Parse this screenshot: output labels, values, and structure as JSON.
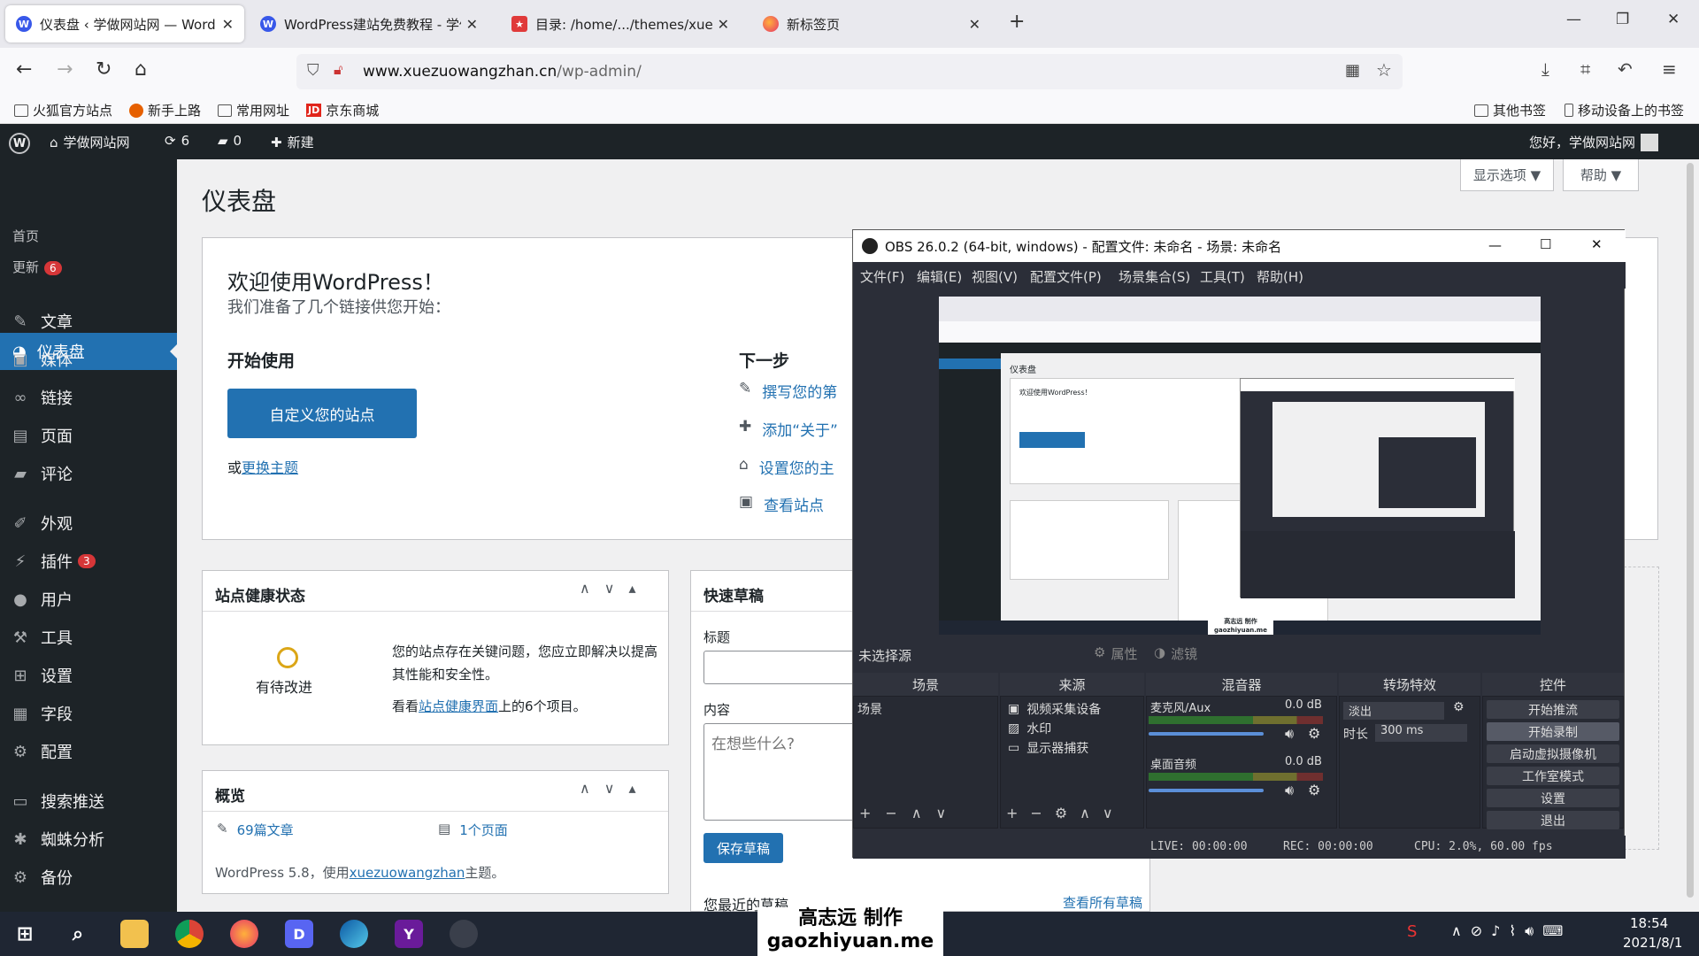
{
  "browser": {
    "tabs": [
      {
        "label": "仪表盘 ‹ 学做网站网 — WordP",
        "active": true,
        "favicon": "wordpress-icon"
      },
      {
        "label": "WordPress建站免费教程 - 学做",
        "active": false,
        "favicon": "wordpress-icon"
      },
      {
        "label": "目录: /home/.../themes/xuezu",
        "active": false,
        "favicon": "bookmark-star-icon"
      },
      {
        "label": "新标签页",
        "active": false,
        "favicon": "firefox-icon"
      }
    ],
    "new_tab": "+",
    "url_domain": "www.xuezuowangzhan.cn",
    "url_path": "/wp-admin/",
    "bookmarks": [
      "火狐官方站点",
      "新手上路",
      "常用网址",
      "京东商城"
    ],
    "bookmarks_right": [
      "其他书签",
      "移动设备上的书签"
    ]
  },
  "adminbar": {
    "site": "学做网站网",
    "updates": "6",
    "comments": "0",
    "new": "新建",
    "greeting": "您好，学做网站网"
  },
  "sidebar": {
    "dashboard": "仪表盘",
    "sub": [
      {
        "label": "首页"
      },
      {
        "label": "更新",
        "badge": "6"
      }
    ],
    "items": [
      {
        "label": "文章",
        "icon": "pin-icon"
      },
      {
        "label": "媒体",
        "icon": "media-icon"
      },
      {
        "label": "链接",
        "icon": "link-icon"
      },
      {
        "label": "页面",
        "icon": "page-icon"
      },
      {
        "label": "评论",
        "icon": "comment-icon"
      },
      {
        "label": "外观",
        "icon": "brush-icon"
      },
      {
        "label": "插件",
        "icon": "plugin-icon",
        "badge": "3"
      },
      {
        "label": "用户",
        "icon": "user-icon"
      },
      {
        "label": "工具",
        "icon": "wrench-icon"
      },
      {
        "label": "设置",
        "icon": "settings-icon"
      },
      {
        "label": "字段",
        "icon": "table-icon"
      },
      {
        "label": "配置",
        "icon": "gear-icon"
      },
      {
        "label": "搜索推送",
        "icon": "search-push-icon"
      },
      {
        "label": "蜘蛛分析",
        "icon": "spider-icon"
      },
      {
        "label": "备份",
        "icon": "backup-icon"
      }
    ]
  },
  "main": {
    "title": "仪表盘",
    "screen_options": "显示选项 ▼",
    "help": "帮助 ▼",
    "welcome": {
      "title": "欢迎使用WordPress！",
      "subtitle": "我们准备了几个链接供您开始：",
      "start_heading": "开始使用",
      "customize_button": "自定义您的站点",
      "or_text": "或",
      "change_theme": "更换主题",
      "next_heading": "下一步",
      "next_items": [
        "撰写您的第",
        "添加“关于”",
        "设置您的主",
        "查看站点"
      ]
    },
    "health": {
      "title": "站点健康状态",
      "status": "有待改进",
      "desc": "您的站点存在关键问题，您应立即解决以提高其性能和安全性。",
      "link_prefix": "看看",
      "link": "站点健康界面",
      "link_suffix": "上的6个项目。"
    },
    "quick_draft": {
      "title": "快速草稿",
      "label_title": "标题",
      "label_content": "内容",
      "placeholder": "在想些什么?",
      "save": "保存草稿",
      "recent": "您最近的草稿",
      "view_all": "查看所有草稿"
    },
    "overview": {
      "title": "概览",
      "posts": "69篇文章",
      "pages": "1个页面",
      "footer_prefix": "WordPress 5.8，使用",
      "theme": "xuezuowangzhan",
      "footer_suffix": "主题。"
    }
  },
  "obs": {
    "title": "OBS 26.0.2 (64-bit, windows) - 配置文件: 未命名 - 场景: 未命名",
    "menu": [
      "文件(F)",
      "编辑(E)",
      "视图(V)",
      "配置文件(P)",
      "场景集合(S)",
      "工具(T)",
      "帮助(H)"
    ],
    "no_source": "未选择源",
    "properties": "属性",
    "filters": "滤镜",
    "panels": {
      "scenes": "场景",
      "sources": "来源",
      "mixer": "混音器",
      "transitions": "转场特效",
      "controls": "控件"
    },
    "scene_item": "场景",
    "sources": [
      "视频采集设备",
      "水印",
      "显示器捕获"
    ],
    "mixer": [
      {
        "name": "麦克风/Aux",
        "level": "0.0 dB",
        "volume": 0.9
      },
      {
        "name": "桌面音频",
        "level": "0.0 dB",
        "volume": 0.9
      }
    ],
    "transition": {
      "type": "淡出",
      "duration_label": "时长",
      "duration": "300 ms"
    },
    "controls": [
      "开始推流",
      "开始录制",
      "启动虚拟摄像机",
      "工作室模式",
      "设置",
      "退出"
    ],
    "status": {
      "live": "LIVE: 00:00:00",
      "rec": "REC: 00:00:00",
      "cpu": "CPU: 2.0%, 60.00 fps"
    },
    "preview_tiny": {
      "dash": "仪表盘",
      "welcome": "欢迎使用WordPress！",
      "watermark_1": "高志远 制作",
      "watermark_2": "gaozhiyuan.me"
    }
  },
  "watermark": {
    "line1": "高志远  制作",
    "line2": "gaozhiyuan.me"
  },
  "taskbar": {
    "time": "18:54",
    "date": "2021/8/1"
  }
}
